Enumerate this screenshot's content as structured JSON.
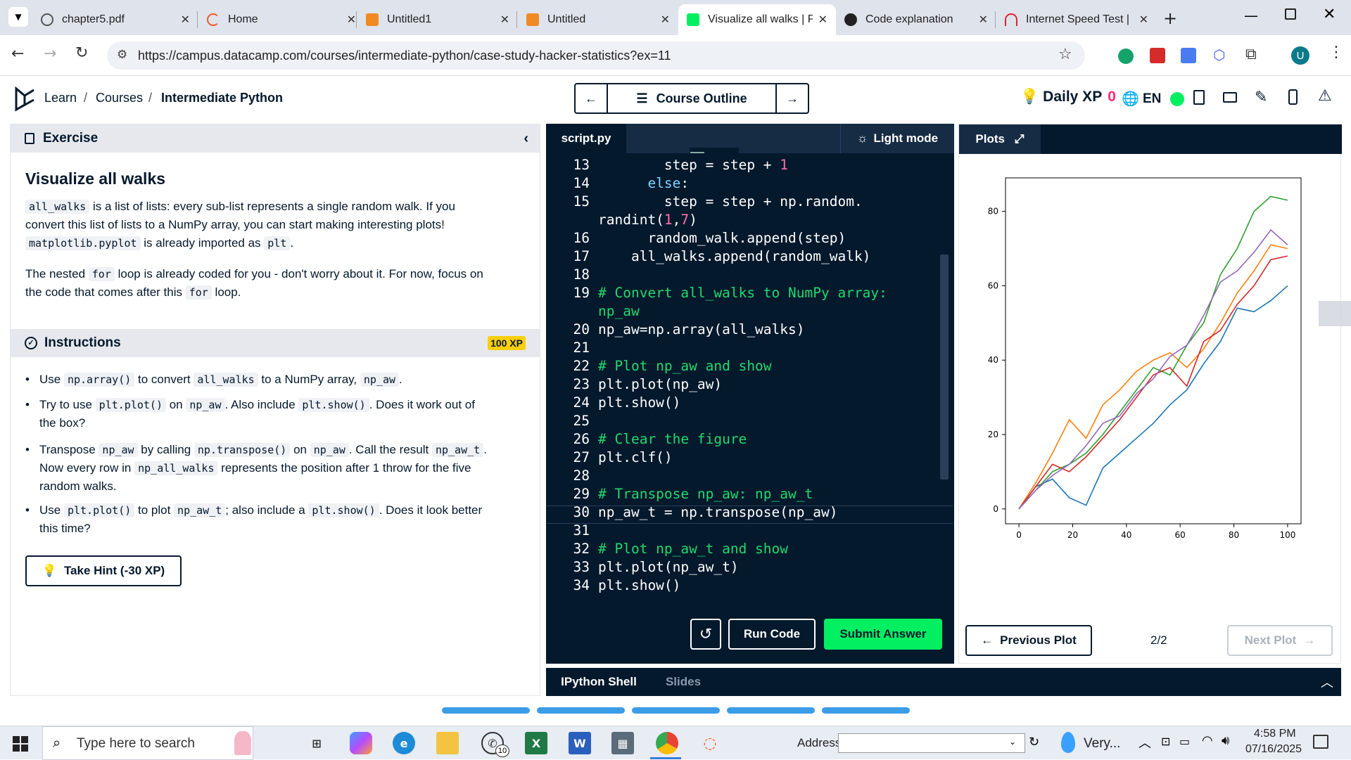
{
  "browser": {
    "tabs": [
      {
        "label": "chapter5.pdf",
        "icon": "globe-icon"
      },
      {
        "label": "Home",
        "icon": "loading-icon"
      },
      {
        "label": "Untitled1",
        "icon": "notebook-icon"
      },
      {
        "label": "Untitled",
        "icon": "notebook-icon"
      },
      {
        "label": "Visualize all walks | P",
        "icon": "datacamp-icon",
        "active": true
      },
      {
        "label": "Code explanation",
        "icon": "openai-icon"
      },
      {
        "label": "Internet Speed Test |",
        "icon": "speedometer-icon"
      }
    ],
    "url": "https://campus.datacamp.com/courses/intermediate-python/case-study-hacker-statistics?ex=11",
    "profile_initial": "U"
  },
  "header": {
    "breadcrumb": [
      "Learn",
      "Courses",
      "Intermediate Python"
    ],
    "sep": "/",
    "course_outline": "Course Outline",
    "daily_xp_label": "Daily XP",
    "daily_xp_value": "0",
    "language": "EN"
  },
  "exercise": {
    "section_title": "Exercise",
    "title": "Visualize all walks",
    "p1": {
      "c1": "all_walks",
      "t1": " is a list of lists: every sub-list represents a single random walk. If you",
      "t2": "convert this list of lists to a NumPy array, you can start making interesting plots!",
      "c2": "matplotlib.pyplot",
      "t3": " is already imported as ",
      "c3": "plt",
      "t4": "."
    },
    "p2": {
      "t1": "The nested ",
      "c1": "for",
      "t2": " loop is already coded for you - don't worry about it. For now, focus on",
      "t3": "the code that comes after this ",
      "c2": "for",
      "t4": " loop."
    }
  },
  "instructions": {
    "title": "Instructions",
    "xp": "100 XP",
    "items": [
      {
        "parts": [
          [
            "t",
            "Use "
          ],
          [
            "c",
            "np.array()"
          ],
          [
            "t",
            " to convert "
          ],
          [
            "c",
            "all_walks"
          ],
          [
            "t",
            " to a NumPy array, "
          ],
          [
            "c",
            "np_aw"
          ],
          [
            "t",
            "."
          ]
        ]
      },
      {
        "parts": [
          [
            "t",
            "Try to use "
          ],
          [
            "c",
            "plt.plot()"
          ],
          [
            "t",
            " on "
          ],
          [
            "c",
            "np_aw"
          ],
          [
            "t",
            ". Also include "
          ],
          [
            "c",
            "plt.show()"
          ],
          [
            "t",
            ". Does it work out of"
          ]
        ],
        "parts2": [
          [
            "t",
            "the box?"
          ]
        ]
      },
      {
        "parts": [
          [
            "t",
            "Transpose "
          ],
          [
            "c",
            "np_aw"
          ],
          [
            "t",
            " by calling "
          ],
          [
            "c",
            "np.transpose()"
          ],
          [
            "t",
            " on "
          ],
          [
            "c",
            "np_aw"
          ],
          [
            "t",
            ". Call the result "
          ],
          [
            "c",
            "np_aw_t"
          ],
          [
            "t",
            "."
          ]
        ],
        "parts2": [
          [
            "t",
            "Now every row in "
          ],
          [
            "c",
            "np_all_walks"
          ],
          [
            "t",
            " represents the position after 1 throw for the five"
          ]
        ],
        "parts3": [
          [
            "t",
            "random walks."
          ]
        ]
      },
      {
        "parts": [
          [
            "t",
            "Use "
          ],
          [
            "c",
            "plt.plot()"
          ],
          [
            "t",
            " to plot "
          ],
          [
            "c",
            "np_aw_t"
          ],
          [
            "t",
            "; also include a "
          ],
          [
            "c",
            "plt.show()"
          ],
          [
            "t",
            ". Does it look better"
          ]
        ],
        "parts2": [
          [
            "t",
            "this time?"
          ]
        ]
      }
    ],
    "hint_button": "Take Hint (-30 XP)"
  },
  "editor": {
    "filename": "script.py",
    "light_mode": "Light mode",
    "lines": [
      {
        "n": "13",
        "segs": [
          [
            "",
            "        step = step + "
          ],
          [
            "num",
            "1"
          ]
        ]
      },
      {
        "n": "14",
        "segs": [
          [
            "kw",
            "      else"
          ],
          [
            "",
            ":"
          ]
        ]
      },
      {
        "n": "15",
        "segs": [
          [
            "",
            "        step = step + np.random."
          ]
        ]
      },
      {
        "n": "",
        "segs": [
          [
            "",
            "randint("
          ],
          [
            "num",
            "1"
          ],
          [
            "",
            ","
          ],
          [
            "num",
            "7"
          ],
          [
            "",
            ")"
          ]
        ]
      },
      {
        "n": "16",
        "segs": [
          [
            "",
            "      random_walk.append(step)"
          ]
        ]
      },
      {
        "n": "17",
        "segs": [
          [
            "",
            "    all_walks.append(random_walk)"
          ]
        ]
      },
      {
        "n": "18",
        "segs": [
          [
            "",
            ""
          ]
        ]
      },
      {
        "n": "19",
        "segs": [
          [
            "cm",
            "# Convert all_walks to NumPy array:"
          ]
        ]
      },
      {
        "n": "",
        "segs": [
          [
            "cm",
            "np_aw"
          ]
        ]
      },
      {
        "n": "20",
        "segs": [
          [
            "",
            "np_aw=np.array(all_walks)"
          ]
        ]
      },
      {
        "n": "21",
        "segs": [
          [
            "",
            ""
          ]
        ]
      },
      {
        "n": "22",
        "segs": [
          [
            "cm",
            "# Plot np_aw and show"
          ]
        ]
      },
      {
        "n": "23",
        "segs": [
          [
            "",
            "plt.plot(np_aw)"
          ]
        ]
      },
      {
        "n": "24",
        "segs": [
          [
            "",
            "plt.show()"
          ]
        ]
      },
      {
        "n": "25",
        "segs": [
          [
            "",
            ""
          ]
        ]
      },
      {
        "n": "26",
        "segs": [
          [
            "cm",
            "# Clear the figure"
          ]
        ]
      },
      {
        "n": "27",
        "segs": [
          [
            "",
            "plt.clf()"
          ]
        ]
      },
      {
        "n": "28",
        "segs": [
          [
            "",
            ""
          ]
        ]
      },
      {
        "n": "29",
        "segs": [
          [
            "cm",
            "# Transpose np_aw: np_aw_t"
          ]
        ]
      },
      {
        "n": "30",
        "segs": [
          [
            "",
            "np_aw_t = np.transpose(np_aw)"
          ]
        ]
      },
      {
        "n": "31",
        "segs": [
          [
            "",
            ""
          ]
        ]
      },
      {
        "n": "32",
        "segs": [
          [
            "cm",
            "# Plot np_aw_t and show"
          ]
        ]
      },
      {
        "n": "33",
        "segs": [
          [
            "",
            "plt.plot(np_aw_t)"
          ]
        ]
      },
      {
        "n": "34",
        "segs": [
          [
            "",
            "plt.show()"
          ]
        ]
      }
    ],
    "run_code": "Run Code",
    "submit": "Submit Answer"
  },
  "plots": {
    "title": "Plots",
    "previous": "Previous Plot",
    "next": "Next Plot",
    "page": "2/2",
    "series_colors": [
      "#1f77b4",
      "#ff7f0e",
      "#2ca02c",
      "#d62728",
      "#9467bd"
    ]
  },
  "chart_data": {
    "type": "line",
    "title": "",
    "xlabel": "",
    "ylabel": "",
    "xlim": [
      -5,
      105
    ],
    "ylim": [
      -4,
      89
    ],
    "xticks": [
      0,
      20,
      40,
      60,
      80,
      100
    ],
    "yticks": [
      0,
      20,
      40,
      60,
      80
    ],
    "x_step": 10,
    "series": [
      {
        "values": [
          0,
          6,
          8,
          3,
          1,
          11,
          15,
          19,
          23,
          28,
          32,
          39,
          45,
          54,
          53,
          56,
          60
        ]
      },
      {
        "values": [
          0,
          7,
          15,
          24,
          19,
          28,
          32,
          37,
          40,
          42,
          38,
          43,
          50,
          58,
          64,
          71,
          70
        ]
      },
      {
        "values": [
          0,
          5,
          10,
          12,
          15,
          20,
          26,
          32,
          38,
          36,
          44,
          50,
          63,
          70,
          80,
          84,
          83
        ]
      },
      {
        "values": [
          0,
          6,
          12,
          10,
          14,
          19,
          24,
          30,
          36,
          38,
          33,
          45,
          48,
          55,
          60,
          67,
          68
        ]
      },
      {
        "values": [
          0,
          5,
          9,
          12,
          17,
          23,
          25,
          31,
          35,
          41,
          44,
          52,
          61,
          64,
          69,
          75,
          71
        ]
      }
    ]
  },
  "shell": {
    "tabs": [
      "IPython Shell",
      "Slides"
    ]
  },
  "taskbar": {
    "search_placeholder": "Type here to search",
    "address_label": "Address",
    "weather": "Very...",
    "time": "4:58 PM",
    "date": "07/16/2025",
    "whatsapp_badge": "10"
  }
}
